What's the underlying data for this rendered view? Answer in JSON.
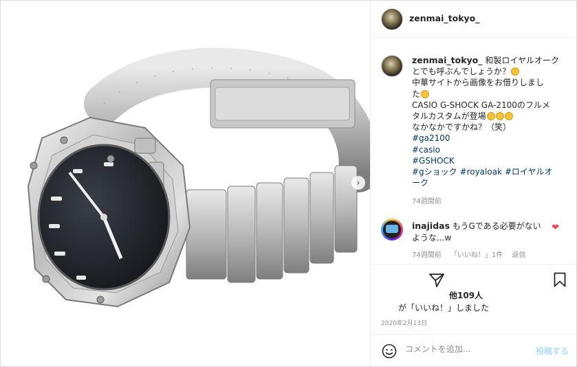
{
  "post": {
    "username": "zenmai_tokyo_",
    "caption_lines": [
      "zenmai_tokyo_ 和製ロイヤルオーク",
      "とでも呼ぶんでしょうか？",
      "中華サイトから画像をお借りしまし",
      "た",
      "CASIO G-SHOCK GA-2100のフルメ",
      "タルカスタムが登場",
      "なかなかですかね？（笑）"
    ],
    "hashtags": [
      "#ga2100",
      "#casio",
      "#GSHOCK"
    ],
    "hashtag_line_last_a": "#gショック",
    "hashtag_line_last_b": "#royaloak",
    "hashtag_line_last_c": "#ロイヤルオ",
    "hashtag_line_last_d": "ーク",
    "time_ago": "74週間前"
  },
  "comment": {
    "username": "inajidas",
    "text_line1": "もうGである必要がない",
    "text_line2": "ような...w",
    "time_ago": "74週間前",
    "likes": "「いいね！」1件",
    "reply": "返信"
  },
  "likes": {
    "line1": "他109人",
    "line2": "が「いいね！」しました"
  },
  "date": "2020年2月13日",
  "add_comment": {
    "placeholder": "コメントを追加...",
    "post_label": "投稿する"
  },
  "colors": {
    "link": "#00376b",
    "muted": "#8e8e8e",
    "heart": "#ed4956",
    "post_disabled": "#b2dffc"
  },
  "icons": {
    "carousel": "chevron-right-icon",
    "share": "paper-plane-icon",
    "save": "bookmark-icon",
    "emoji": "smile-icon",
    "like": "heart-icon"
  }
}
